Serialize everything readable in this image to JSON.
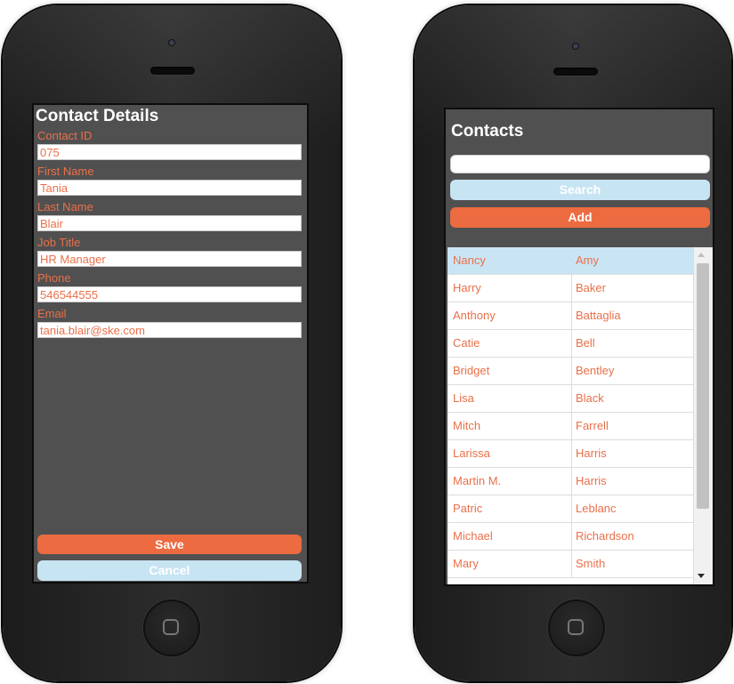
{
  "contact_details": {
    "title": "Contact Details",
    "fields": [
      {
        "label": "Contact ID",
        "value": "075"
      },
      {
        "label": "First Name",
        "value": "Tania"
      },
      {
        "label": "Last Name",
        "value": "Blair"
      },
      {
        "label": "Job Title",
        "value": "HR Manager"
      },
      {
        "label": "Phone",
        "value": "546544555"
      },
      {
        "label": "Email",
        "value": "tania.blair@ske.com"
      }
    ],
    "save_label": "Save",
    "cancel_label": "Cancel"
  },
  "contacts": {
    "title": "Contacts",
    "search_value": "",
    "search_label": "Search",
    "add_label": "Add",
    "rows": [
      {
        "first": "Nancy",
        "last": "Amy",
        "selected": true
      },
      {
        "first": "Harry",
        "last": "Baker"
      },
      {
        "first": "Anthony",
        "last": "Battaglia"
      },
      {
        "first": "Catie",
        "last": "Bell"
      },
      {
        "first": "Bridget",
        "last": "Bentley"
      },
      {
        "first": "Lisa",
        "last": "Black"
      },
      {
        "first": "Mitch",
        "last": "Farrell"
      },
      {
        "first": "Larissa",
        "last": "Harris"
      },
      {
        "first": "Martin M.",
        "last": "Harris"
      },
      {
        "first": "Patric",
        "last": "Leblanc"
      },
      {
        "first": "Michael",
        "last": "Richardson"
      },
      {
        "first": "Mary",
        "last": "Smith"
      }
    ]
  },
  "colors": {
    "accent_orange": "#ec6b40",
    "light_blue": "#c7e4f3",
    "screen_gray": "#505050",
    "label_text": "#e9704a"
  }
}
